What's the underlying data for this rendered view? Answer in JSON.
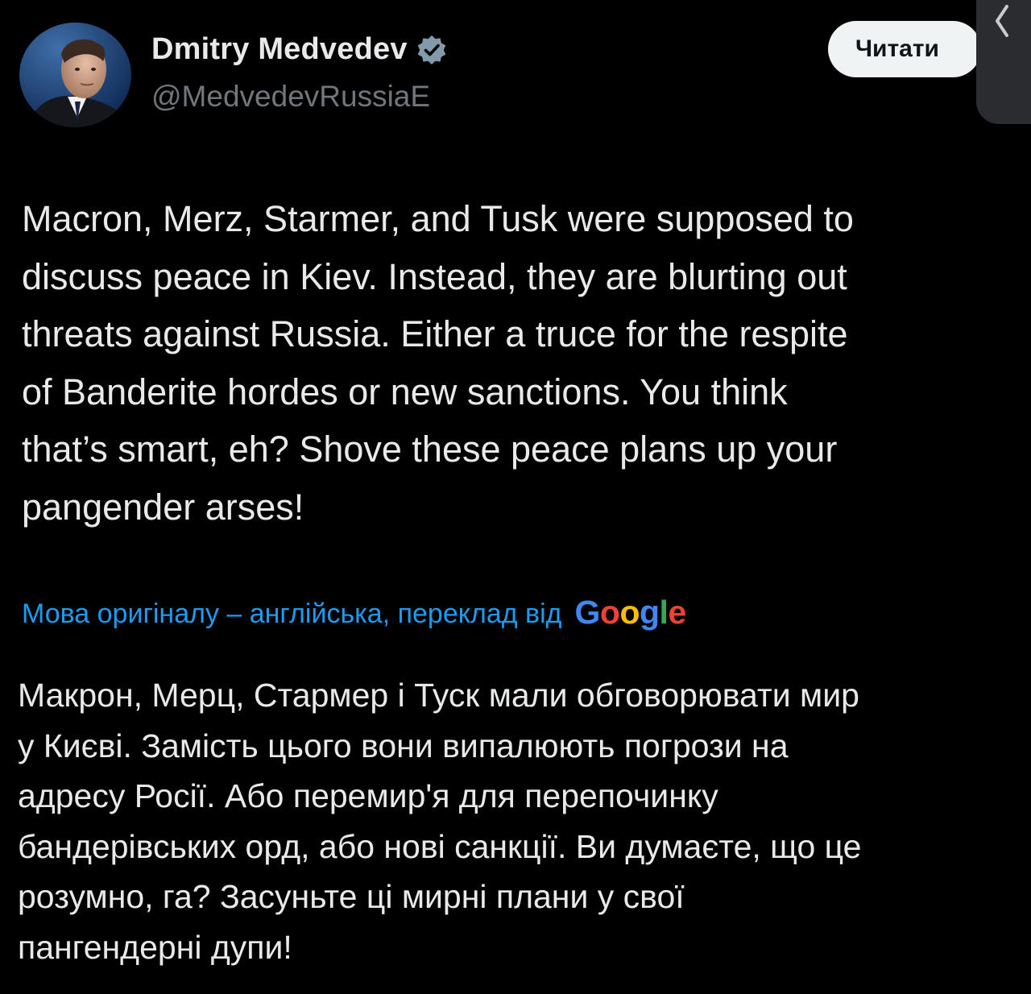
{
  "author": {
    "name": "Dmitry Medvedev",
    "handle": "@MedvedevRussiaE",
    "verified_icon": "verified-badge-icon"
  },
  "header": {
    "read_button_label": "Читати",
    "side_chevron_icon": "chevron-left-icon"
  },
  "tweet": {
    "lines": [
      "Macron, Merz, Starmer, and Tusk were supposed to",
      "discuss peace in Kiev. Instead, they are blurting out",
      "threats against Russia. Either a truce for the respite",
      "of Banderite hordes or new sanctions. You think",
      "that’s smart, eh? Shove these peace plans up your",
      "pangender arses!"
    ]
  },
  "translation": {
    "note": "Мова оригіналу – англійська, переклад від",
    "provider_logo": [
      "G",
      "o",
      "o",
      "g",
      "l",
      "e"
    ],
    "lines": [
      "Макрон, Мерц, Стармер і Туск мали обговорювати мир",
      "у Києві. Замість цього вони випалюють погрози на",
      "адресу Росії. Або перемир'я для перепочинку",
      "бандерівських орд, або нові санкції. Ви думаєте, що це",
      "розумно, га? Засуньте ці мирні плани у свої",
      "пангендерні дупи!"
    ]
  },
  "colors": {
    "background": "#000000",
    "text": "#e7e9ea",
    "secondary_text": "#71767b",
    "link": "#1d9bf0",
    "verified": "#829aab",
    "button_bg": "#eff3f4"
  }
}
